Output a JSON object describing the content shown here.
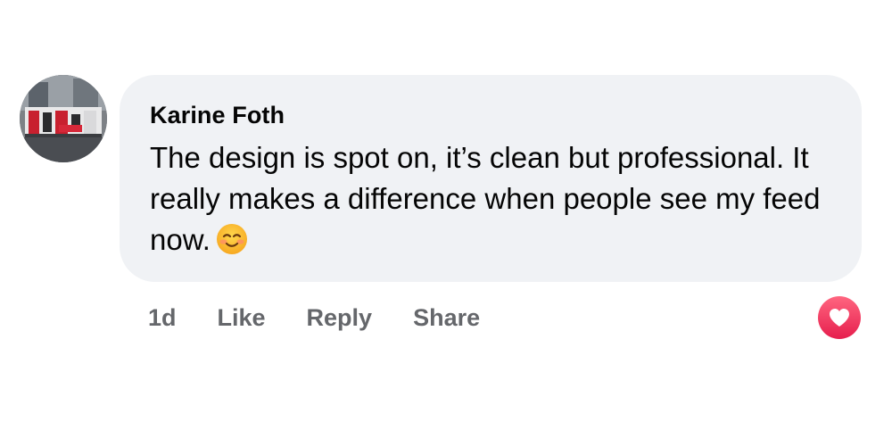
{
  "comment": {
    "author": "Karine Foth",
    "text": "The design is spot on, it’s clean but professional. It really makes a difference when people see my feed now.",
    "emoji": "smiling-face-with-smiling-eyes-emoji"
  },
  "actions": {
    "timestamp": "1d",
    "like_label": "Like",
    "reply_label": "Reply",
    "share_label": "Share"
  },
  "reaction": {
    "icon": "heart-icon",
    "color": "#f0284a"
  },
  "colors": {
    "bubble_background": "#f0f2f5",
    "secondary_text": "#65676b",
    "primary_text": "#050505"
  }
}
